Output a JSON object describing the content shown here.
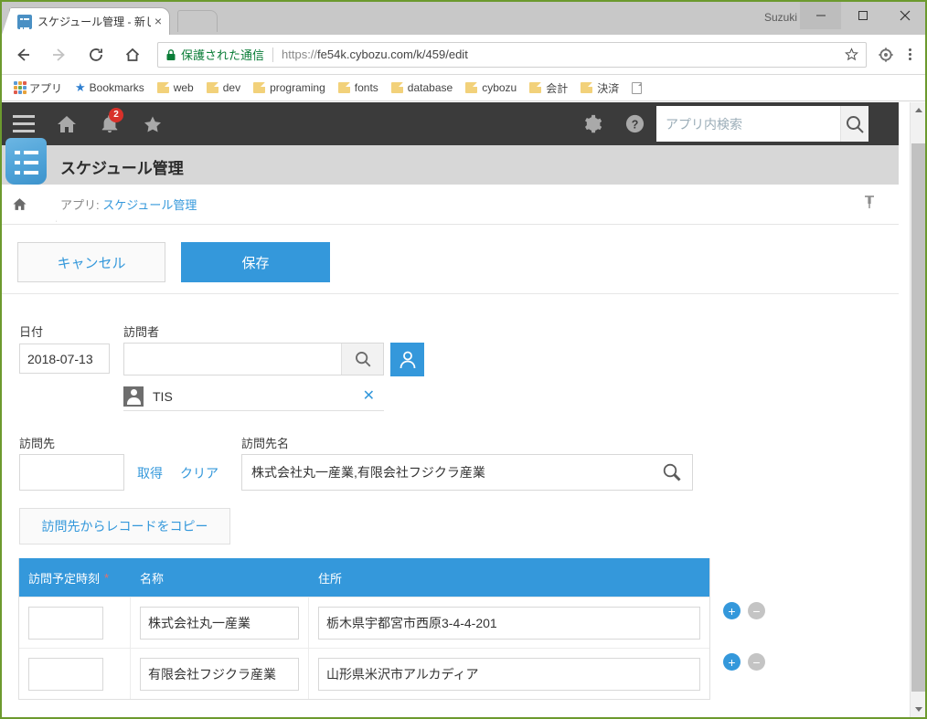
{
  "window": {
    "user": "Suzuki",
    "minimize_label": "minimize",
    "maximize_label": "maximize",
    "close_label": "close"
  },
  "browser": {
    "tab": {
      "title": "スケジュール管理 - 新しいレ",
      "close_label": "×"
    },
    "omnibox": {
      "secure_text": "保護された通信",
      "url_scheme": "https://",
      "url_rest": "fe54k.cybozu.com/k/459/edit"
    },
    "bookmarks": [
      {
        "label": "アプリ",
        "icon": "apps-grid-icon"
      },
      {
        "label": "Bookmarks",
        "icon": "star-icon"
      },
      {
        "label": "web",
        "icon": "folder-icon"
      },
      {
        "label": "dev",
        "icon": "folder-icon"
      },
      {
        "label": "programing",
        "icon": "folder-icon"
      },
      {
        "label": "fonts",
        "icon": "folder-icon"
      },
      {
        "label": "database",
        "icon": "folder-icon"
      },
      {
        "label": "cybozu",
        "icon": "folder-icon"
      },
      {
        "label": "会計",
        "icon": "folder-icon"
      },
      {
        "label": "決済",
        "icon": "folder-icon"
      },
      {
        "label": "",
        "icon": "page-icon"
      }
    ]
  },
  "app_header": {
    "menu_icon": "hamburger-icon",
    "home_icon": "home-icon",
    "bell_icon": "bell-icon",
    "notification_count": "2",
    "favorite_icon": "star-icon",
    "settings_icon": "gear-icon",
    "help_icon": "help-icon",
    "search_placeholder": "アプリ内検索",
    "search_value": "",
    "search_icon": "search-icon"
  },
  "app": {
    "icon": "list-app-icon",
    "title": "スケジュール管理"
  },
  "breadcrumb": {
    "home_icon": "home-icon",
    "prefix": "アプリ: ",
    "link": "スケジュール管理",
    "pin_icon": "pin-icon"
  },
  "toolbar": {
    "cancel_label": "キャンセル",
    "save_label": "保存"
  },
  "form": {
    "date": {
      "label": "日付",
      "value": "2018-07-13"
    },
    "visitor": {
      "label": "訪問者",
      "search_value": "",
      "search_icon": "search-icon",
      "picker_icon": "person-icon",
      "chip": {
        "avatar_icon": "person-avatar-icon",
        "name": "TIS",
        "remove_icon": "close-icon"
      }
    },
    "destination": {
      "label": "訪問先",
      "value": "",
      "get_link": "取得",
      "clear_link": "クリア"
    },
    "destination_name": {
      "label": "訪問先名",
      "value": "株式会社丸一産業,有限会社フジクラ産業",
      "search_icon": "search-icon"
    },
    "copy_button": "訪問先からレコードをコピー"
  },
  "subtable": {
    "columns": [
      {
        "label": "訪問予定時刻",
        "required": true,
        "required_mark": "*"
      },
      {
        "label": "名称",
        "required": false,
        "required_mark": ""
      },
      {
        "label": "住所",
        "required": false,
        "required_mark": ""
      }
    ],
    "rows": [
      {
        "time": "",
        "name": "株式会社丸一産業",
        "address": "栃木県宇都宮市西原3-4-4-201"
      },
      {
        "time": "",
        "name": "有限会社フジクラ産業",
        "address": "山形県米沢市アルカディア"
      }
    ],
    "add_label": "+",
    "remove_label": "−"
  },
  "colors": {
    "accent_blue": "#3498db",
    "header_dark": "#3b3b3b",
    "appbar_gray": "#d7d7d7",
    "badge_red": "#d8312a",
    "secure_green": "#0b7d38",
    "window_border": "#6c9a2e"
  }
}
